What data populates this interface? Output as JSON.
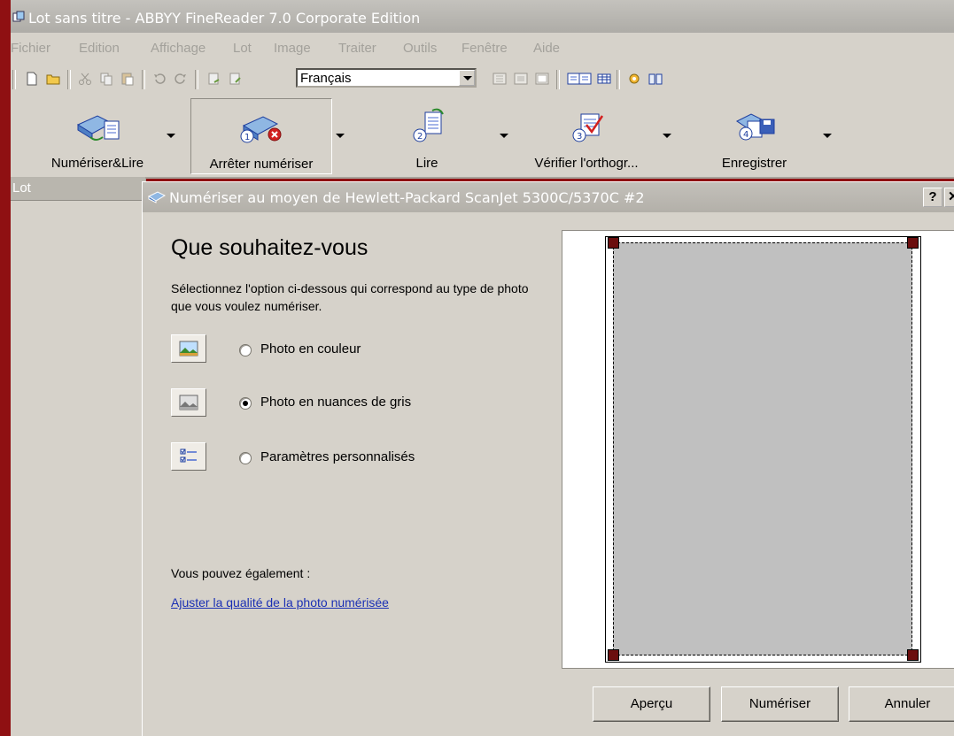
{
  "window": {
    "title": "Lot sans titre - ABBYY FineReader 7.0 Corporate Edition",
    "app_icon": "finereader-batch-icon"
  },
  "menu": [
    "Fichier",
    "Edition",
    "Affichage",
    "Lot",
    "Image",
    "Traiter",
    "Outils",
    "Fenêtre",
    "Aide"
  ],
  "toolbar": {
    "language": "Français",
    "icons": [
      "new-icon",
      "open-icon",
      "cut-icon",
      "copy-icon",
      "paste-icon",
      "undo-icon",
      "redo-icon",
      "page-prev-icon",
      "page-next-icon",
      "view-icon",
      "zoom-icon",
      "layout-icon",
      "split-view-icon",
      "table-icon",
      "options-icon",
      "help-book-icon"
    ]
  },
  "big_buttons": [
    {
      "label": "Numériser&Lire",
      "pressed": false
    },
    {
      "label": "Arrêter numériser",
      "pressed": true
    },
    {
      "label": "Lire",
      "pressed": false
    },
    {
      "label": "Vérifier l'orthogr...",
      "pressed": false
    },
    {
      "label": "Enregistrer",
      "pressed": false
    }
  ],
  "lot_pane": {
    "header": "Lot"
  },
  "dialog": {
    "title": "Numériser au moyen de Hewlett-Packard ScanJet 5300C/5370C #2",
    "help": "?",
    "close": "✕",
    "heading": "Que souhaitez-vous",
    "instructions": "Sélectionnez l'option ci-dessous qui correspond au type de photo que vous voulez numériser.",
    "options": [
      {
        "label": "Photo en couleur",
        "icon": "color-photo-icon",
        "checked": false
      },
      {
        "label": "Photo en nuances de gris",
        "icon": "grayscale-photo-icon",
        "checked": true
      },
      {
        "label": "Paramètres personnalisés",
        "icon": "custom-settings-icon",
        "checked": false
      }
    ],
    "also_label": "Vous pouvez également :",
    "adjust_link": "Ajuster la qualité de la photo numérisée",
    "buttons": {
      "preview": "Aperçu",
      "scan": "Numériser",
      "cancel": "Annuler"
    }
  },
  "colors": {
    "desktop": "#8f1012",
    "window_bg": "#d6d2ca",
    "link": "#1a2fb4",
    "scan_area": "#c0c0c0",
    "handle": "#6b0e0e"
  }
}
